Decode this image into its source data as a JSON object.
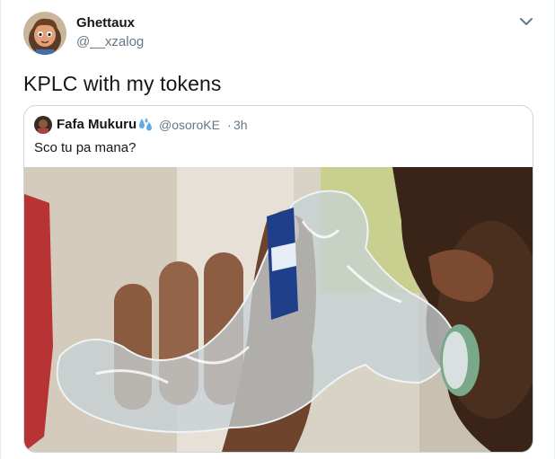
{
  "tweet": {
    "author_name": "Ghettaux",
    "author_handle": "@__xzalog",
    "text": "KPLC with my tokens"
  },
  "quoted_tweet": {
    "author_name": "Fafa Mukuru",
    "author_handle": "@osoroKE",
    "separator": "·",
    "time": "3h",
    "text": "Sco tu pa mana?",
    "media_label": "photo of a hand pouring from a crumpled water bottle into a mouth"
  },
  "colors": {
    "text": "#14171a",
    "secondary": "#657786",
    "border": "#ccd6dd",
    "accent": "#1da1f2"
  },
  "icons": {
    "menu": "chevron-down-icon",
    "name_emoji": "sweat-droplets-icon"
  }
}
